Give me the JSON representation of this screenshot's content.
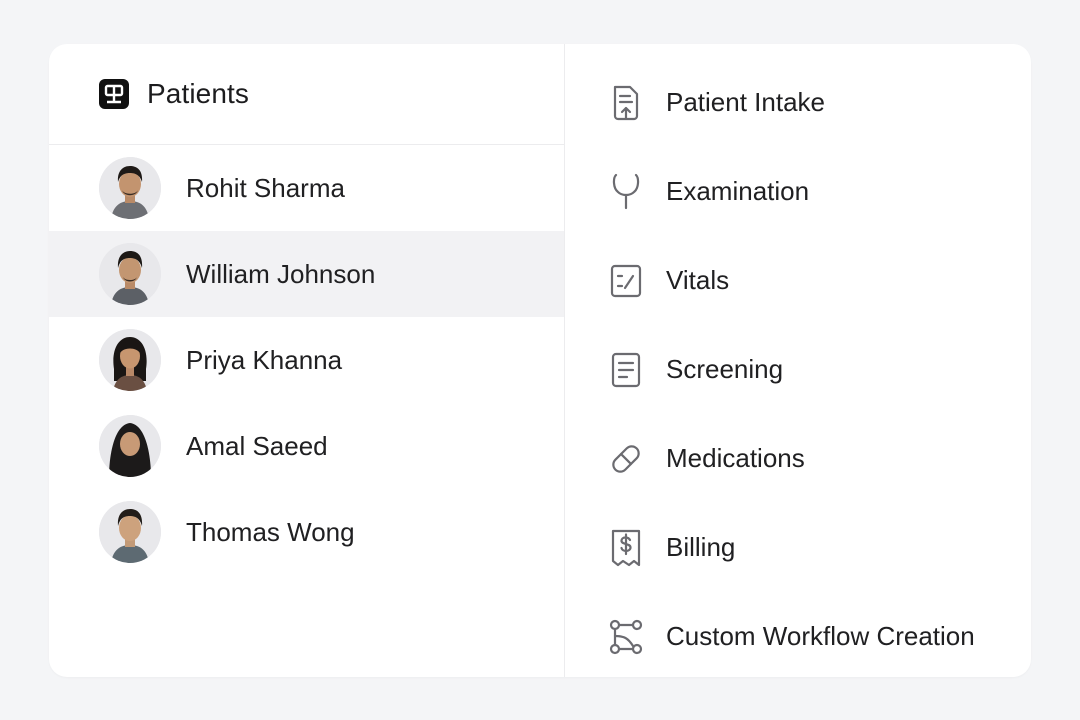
{
  "patients_panel": {
    "title": "Patients",
    "icon": "hospital-sign-icon",
    "selected_index": 1,
    "patients": [
      {
        "name": "Rohit Sharma",
        "avatar_style": "man-short-hair"
      },
      {
        "name": "William Johnson",
        "avatar_style": "man-short-hair"
      },
      {
        "name": "Priya Khanna",
        "avatar_style": "woman-long-hair"
      },
      {
        "name": "Amal Saeed",
        "avatar_style": "woman-hijab"
      },
      {
        "name": "Thomas Wong",
        "avatar_style": "man-short-hair"
      }
    ]
  },
  "workflows_panel": {
    "items": [
      {
        "label": "Patient Intake",
        "icon": "document-upload-icon"
      },
      {
        "label": "Examination",
        "icon": "stethoscope-icon"
      },
      {
        "label": "Vitals",
        "icon": "vitals-chart-icon"
      },
      {
        "label": "Screening",
        "icon": "document-lines-icon"
      },
      {
        "label": "Medications",
        "icon": "pill-icon"
      },
      {
        "label": "Billing",
        "icon": "receipt-dollar-icon"
      },
      {
        "label": "Custom Workflow Creation",
        "icon": "workflow-nodes-icon"
      }
    ]
  },
  "colors": {
    "background": "#f4f5f7",
    "card": "#ffffff",
    "selected_row": "#f2f2f4",
    "icon_stroke": "#6b6b70",
    "text": "#202022"
  }
}
